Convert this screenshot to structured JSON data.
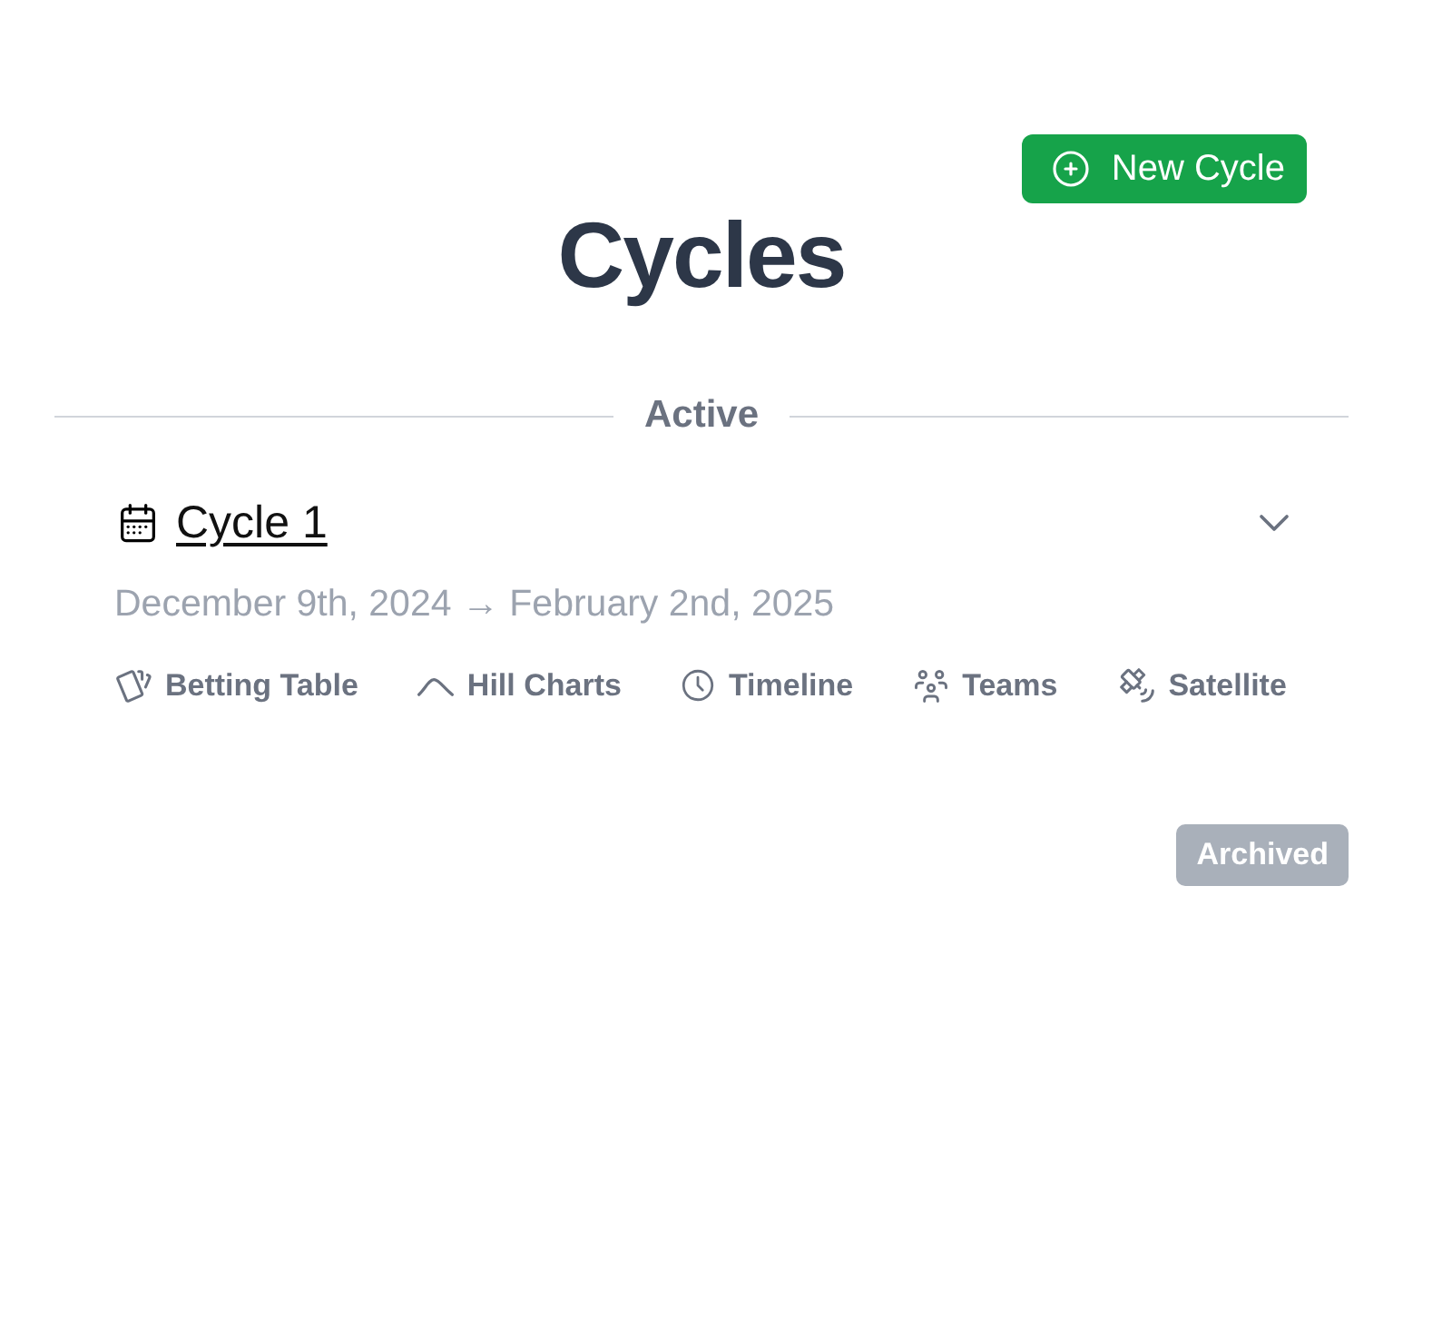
{
  "header": {
    "new_button": {
      "label": "New Cycle"
    },
    "title": "Cycles"
  },
  "section": {
    "label": "Active"
  },
  "cycles": [
    {
      "name": "Cycle 1",
      "dates": "December 9th, 2024 → February 2nd, 2025",
      "links": [
        {
          "label": "Betting Table"
        },
        {
          "label": "Hill Charts"
        },
        {
          "label": "Timeline"
        },
        {
          "label": "Teams"
        },
        {
          "label": "Satellite"
        }
      ]
    }
  ],
  "archived_button": {
    "label": "Archived"
  }
}
